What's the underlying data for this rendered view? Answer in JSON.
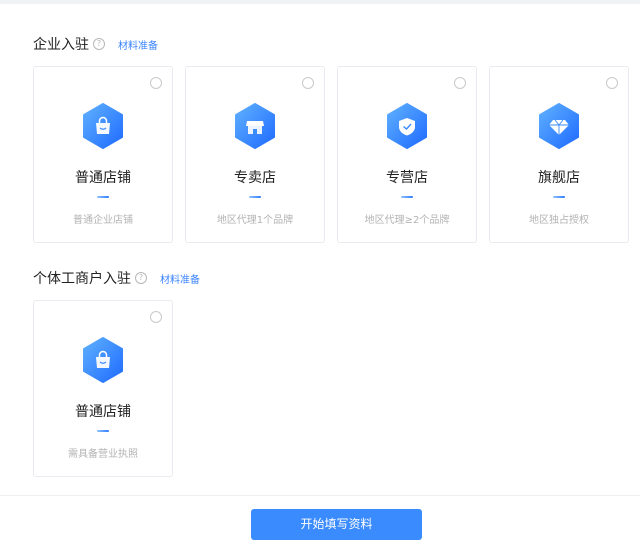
{
  "enterprise": {
    "title": "企业入驻",
    "materials_link": "材料准备",
    "cards": [
      {
        "name": "普通店铺",
        "desc": "普通企业店铺",
        "icon": "shopping-bag-icon"
      },
      {
        "name": "专卖店",
        "desc": "地区代理1个品牌",
        "icon": "storefront-icon"
      },
      {
        "name": "专营店",
        "desc": "地区代理≥2个品牌",
        "icon": "shield-icon"
      },
      {
        "name": "旗舰店",
        "desc": "地区独占授权",
        "icon": "diamond-icon"
      }
    ]
  },
  "individual": {
    "title": "个体工商户入驻",
    "materials_link": "材料准备",
    "cards": [
      {
        "name": "普通店铺",
        "desc": "需具备营业执照",
        "icon": "shopping-bag-icon"
      }
    ]
  },
  "footer": {
    "submit_label": "开始填写资料"
  },
  "colors": {
    "accent": "#3a8bfd",
    "link": "#3a84ff",
    "icon_gradient_light": "#5fb0ff",
    "icon_gradient_dark": "#1f6bff"
  }
}
